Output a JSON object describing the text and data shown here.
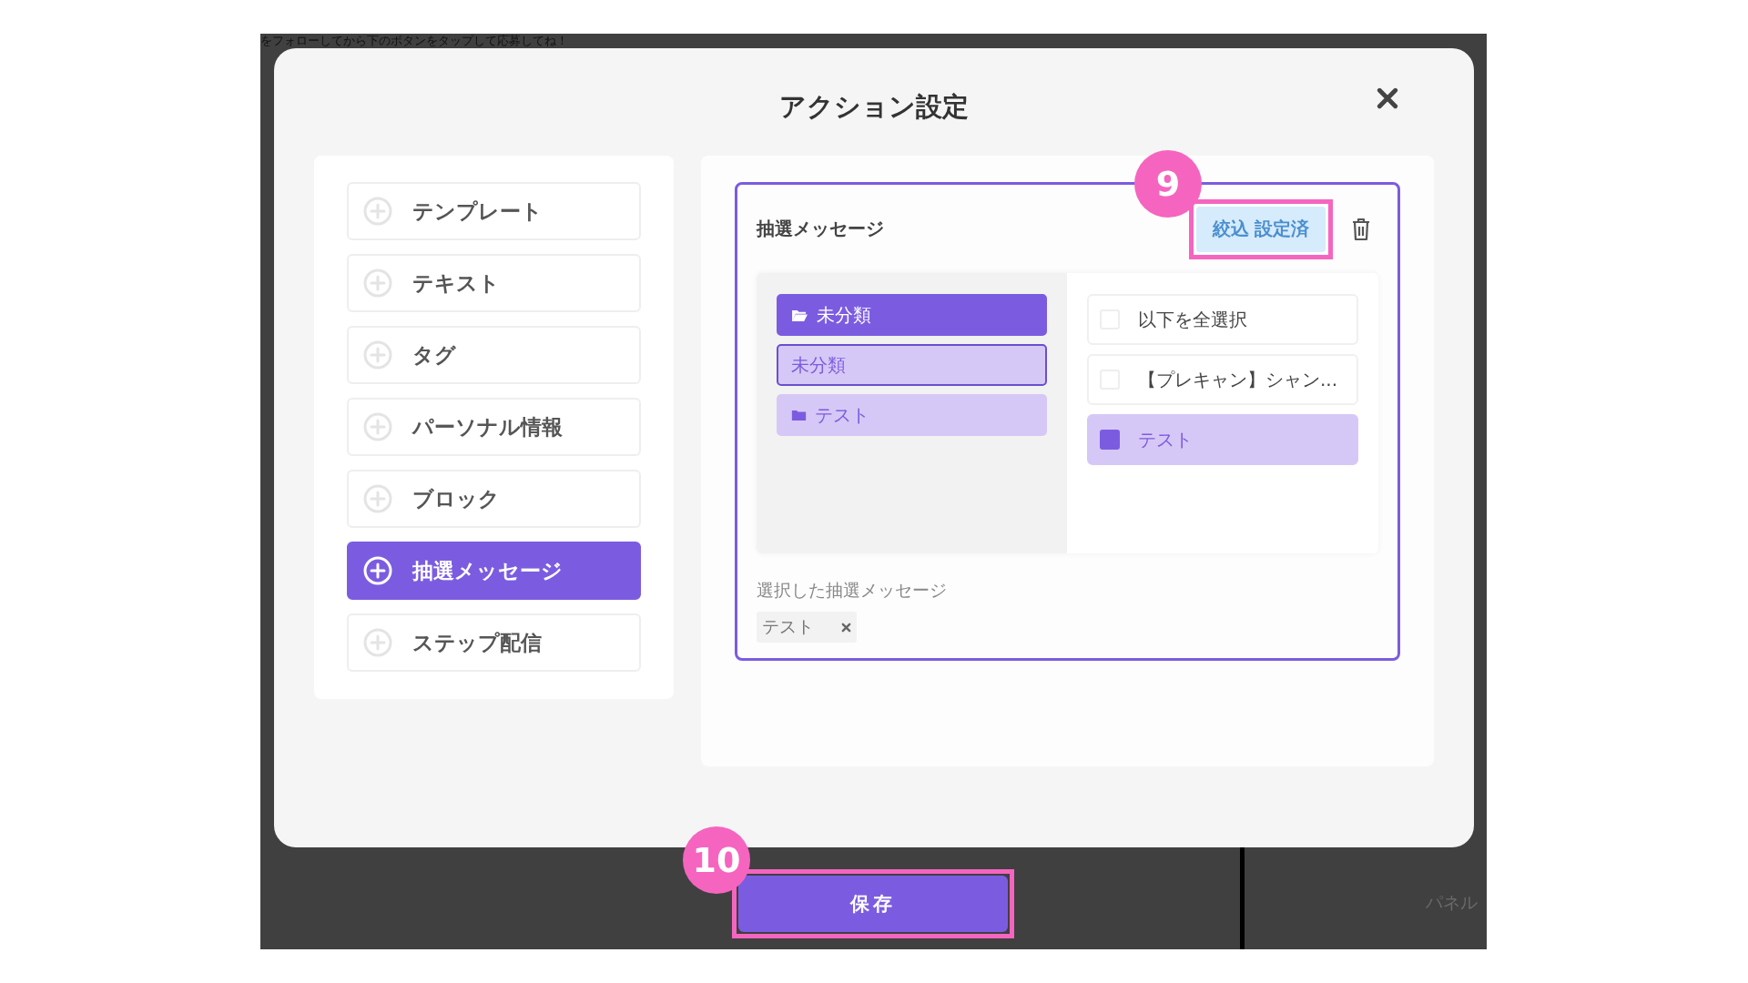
{
  "background_page": {
    "notice": "をフォローしてから下のボタンをタップして応募してね！",
    "panel_label": "パネル"
  },
  "modal": {
    "title": "アクション設定",
    "action_menu": [
      {
        "label": "テンプレート",
        "selected": false
      },
      {
        "label": "テキスト",
        "selected": false
      },
      {
        "label": "タグ",
        "selected": false
      },
      {
        "label": "パーソナル情報",
        "selected": false
      },
      {
        "label": "ブロック",
        "selected": false
      },
      {
        "label": "抽選メッセージ",
        "selected": true
      },
      {
        "label": "ステップ配信",
        "selected": false
      }
    ],
    "message_card": {
      "title": "抽選メッセージ",
      "filter_button": "絞込 設定済",
      "folders": [
        {
          "label": "未分類",
          "kind": "open-folder",
          "selected": true
        },
        {
          "label": "未分類",
          "kind": "category",
          "selected": true
        },
        {
          "label": "テスト",
          "kind": "folder",
          "selected": false
        }
      ],
      "messages": [
        {
          "label": "以下を全選択",
          "checked": false,
          "selected": false
        },
        {
          "label": "【プレキャン】シャン...",
          "checked": false,
          "selected": false
        },
        {
          "label": "テスト",
          "checked": true,
          "selected": true
        }
      ],
      "selected_label": "選択した抽選メッセージ",
      "selected_chips": [
        {
          "label": "テスト"
        }
      ]
    }
  },
  "save_button": "保存",
  "annotations": [
    {
      "number": "9"
    },
    {
      "number": "10"
    }
  ]
}
